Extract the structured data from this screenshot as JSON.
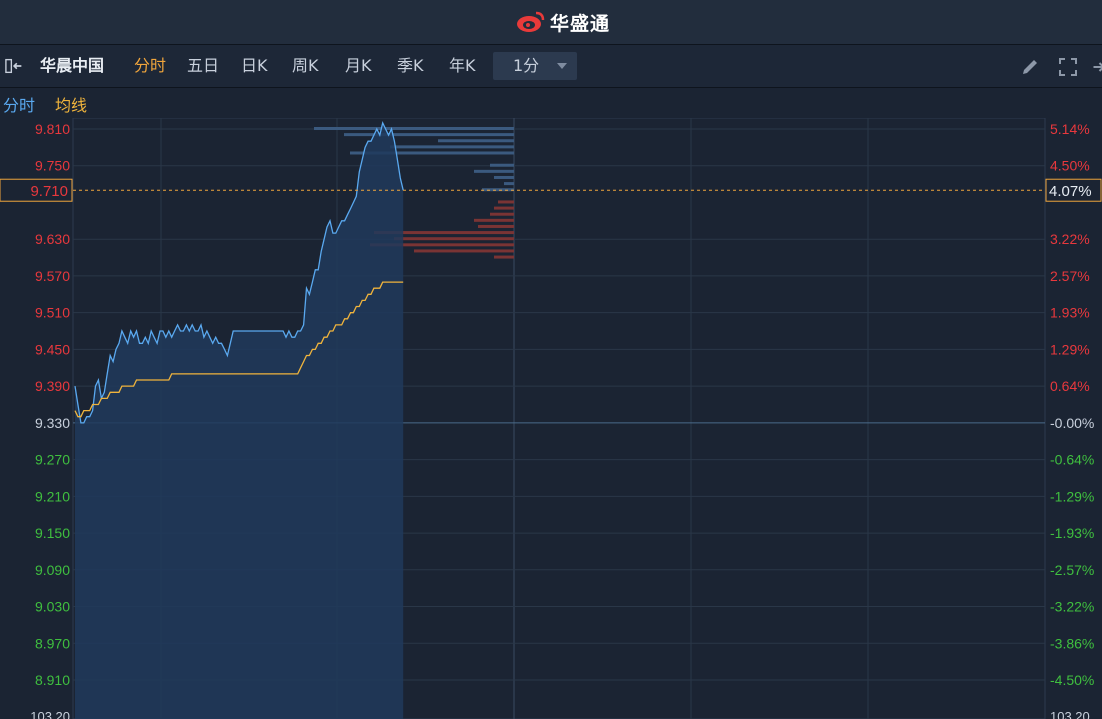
{
  "header": {
    "brand": "华盛通"
  },
  "toolbar": {
    "stock_name": "华晨中国",
    "tabs": [
      "分时",
      "五日",
      "日K",
      "周K",
      "月K",
      "季K",
      "年K"
    ],
    "active_tab": "分时",
    "interval": "1分"
  },
  "legend": {
    "price_label": "分时",
    "avg_label": "均线"
  },
  "colors": {
    "up": "#e8383d",
    "down": "#3fbf3f",
    "price_line": "#5aa9f0",
    "avg_line": "#f0b43c",
    "accent": "#f0a53c"
  },
  "chart_data": {
    "type": "line",
    "prev_close": 9.33,
    "ylim": [
      8.85,
      9.84
    ],
    "price_ticks": [
      "9.810",
      "9.750",
      "9.630",
      "9.570",
      "9.510",
      "9.450",
      "9.390",
      "9.330",
      "9.270",
      "9.210",
      "9.150",
      "9.090",
      "9.030",
      "8.970",
      "8.910"
    ],
    "pct_ticks": [
      "5.14%",
      "4.50%",
      "3.22%",
      "2.57%",
      "1.93%",
      "1.29%",
      "0.64%",
      "-0.00%",
      "-0.64%",
      "-1.29%",
      "-1.93%",
      "-2.57%",
      "-3.22%",
      "-3.86%",
      "-4.50%"
    ],
    "current_price": "9.710",
    "current_pct": "4.07%",
    "bottom_left_label": "103.20",
    "bottom_right_label": "103.20",
    "series": [
      {
        "values": [
          9.39,
          9.36,
          9.33,
          9.33,
          9.34,
          9.34,
          9.35,
          9.39,
          9.4,
          9.37,
          9.38,
          9.41,
          9.44,
          9.43,
          9.45,
          9.46,
          9.48,
          9.47,
          9.46,
          9.48,
          9.47,
          9.48,
          9.46,
          9.46,
          9.47,
          9.46,
          9.48,
          9.47,
          9.46,
          9.48,
          9.48,
          9.47,
          9.48,
          9.47,
          9.48,
          9.49,
          9.48,
          9.48,
          9.49,
          9.48,
          9.49,
          9.48,
          9.48,
          9.49,
          9.47,
          9.48,
          9.47,
          9.46,
          9.47,
          9.46,
          9.46,
          9.45,
          9.44,
          9.46,
          9.48,
          9.48,
          9.48,
          9.48,
          9.48,
          9.48,
          9.48,
          9.48,
          9.48,
          9.48,
          9.48,
          9.48,
          9.48,
          9.48,
          9.48,
          9.48,
          9.48,
          9.48,
          9.47,
          9.48,
          9.47,
          9.47,
          9.48,
          9.48,
          9.49,
          9.55,
          9.54,
          9.56,
          9.58,
          9.58,
          9.61,
          9.63,
          9.65,
          9.66,
          9.64,
          9.64,
          9.65,
          9.66,
          9.66,
          9.67,
          9.68,
          9.69,
          9.7,
          9.74,
          9.76,
          9.78,
          9.79,
          9.79,
          9.8,
          9.81,
          9.8,
          9.82,
          9.81,
          9.8,
          9.81,
          9.79,
          9.76,
          9.73,
          9.71
        ]
      },
      {
        "values": [
          9.35,
          9.34,
          9.34,
          9.35,
          9.35,
          9.35,
          9.36,
          9.36,
          9.36,
          9.37,
          9.37,
          9.37,
          9.38,
          9.38,
          9.38,
          9.38,
          9.39,
          9.39,
          9.39,
          9.39,
          9.39,
          9.4,
          9.4,
          9.4,
          9.4,
          9.4,
          9.4,
          9.4,
          9.4,
          9.4,
          9.4,
          9.4,
          9.4,
          9.41,
          9.41,
          9.41,
          9.41,
          9.41,
          9.41,
          9.41,
          9.41,
          9.41,
          9.41,
          9.41,
          9.41,
          9.41,
          9.41,
          9.41,
          9.41,
          9.41,
          9.41,
          9.41,
          9.41,
          9.41,
          9.41,
          9.41,
          9.41,
          9.41,
          9.41,
          9.41,
          9.41,
          9.41,
          9.41,
          9.41,
          9.41,
          9.41,
          9.41,
          9.41,
          9.41,
          9.41,
          9.41,
          9.41,
          9.41,
          9.41,
          9.41,
          9.41,
          9.41,
          9.42,
          9.43,
          9.44,
          9.44,
          9.45,
          9.45,
          9.46,
          9.46,
          9.47,
          9.47,
          9.48,
          9.48,
          9.49,
          9.49,
          9.49,
          9.5,
          9.5,
          9.51,
          9.51,
          9.52,
          9.52,
          9.53,
          9.53,
          9.54,
          9.54,
          9.55,
          9.55,
          9.55,
          9.56,
          9.56,
          9.56,
          9.56,
          9.56,
          9.56,
          9.56,
          9.56
        ]
      }
    ],
    "order_book": {
      "ask_levels": [
        9.81,
        9.8,
        9.79,
        9.78,
        9.77,
        9.75,
        9.74,
        9.73,
        9.72,
        9.71
      ],
      "ask_depth": [
        1.0,
        0.85,
        0.38,
        0.62,
        0.82,
        0.12,
        0.2,
        0.1,
        0.05,
        0.16
      ],
      "bid_levels": [
        9.69,
        9.68,
        9.67,
        9.66,
        9.65,
        9.64,
        9.63,
        9.62,
        9.61,
        9.6
      ],
      "bid_depth": [
        0.08,
        0.1,
        0.12,
        0.2,
        0.18,
        0.7,
        0.6,
        0.72,
        0.5,
        0.1
      ]
    }
  }
}
